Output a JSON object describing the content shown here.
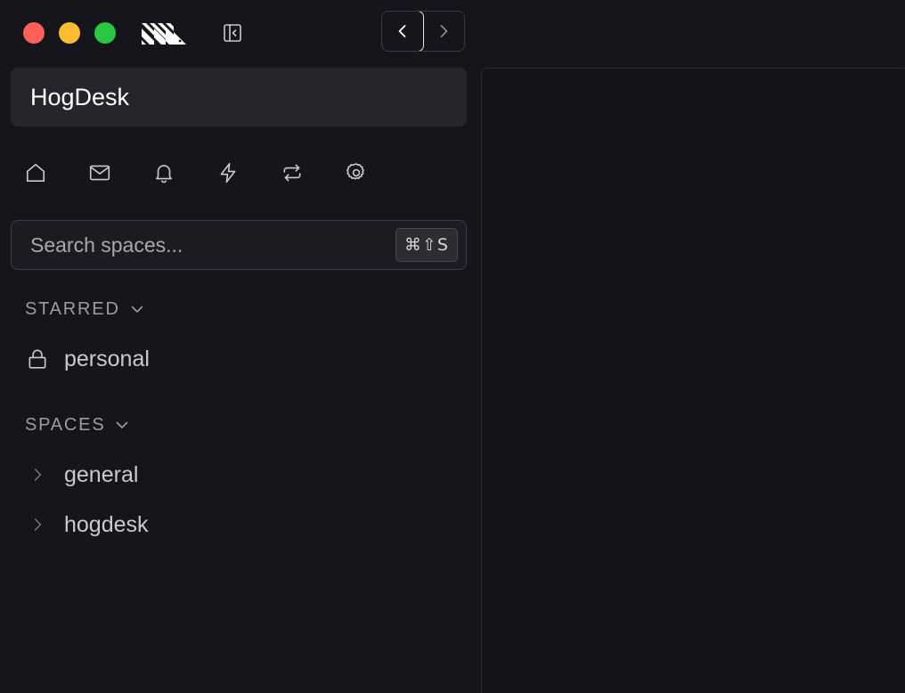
{
  "window": {
    "controls": {
      "close": "#fe5f57",
      "minimize": "#febc2e",
      "zoom": "#28c840"
    }
  },
  "toolbar": {
    "logo_icon": "hogdesk-logo-icon",
    "sidebar_toggle_icon": "sidebar-collapse-icon",
    "back_icon": "chevron-left-icon",
    "forward_icon": "chevron-right-icon"
  },
  "workspace": {
    "name": "HogDesk"
  },
  "nav_icons": [
    "home-icon",
    "inbox-icon",
    "bell-icon",
    "lightning-icon",
    "repeat-icon",
    "gear-icon"
  ],
  "search": {
    "placeholder": "Search spaces...",
    "shortcut": "⌘⇧S"
  },
  "starred": {
    "header": "STARRED",
    "items": [
      {
        "label": "personal",
        "icon": "lock-icon"
      }
    ]
  },
  "spaces": {
    "header": "SPACES",
    "items": [
      {
        "label": "general",
        "icon": "chevron-right-icon"
      },
      {
        "label": "hogdesk",
        "icon": "chevron-right-icon"
      }
    ]
  },
  "colors": {
    "background": "#15161b",
    "surface": "#25262c",
    "border": "#3a3c44",
    "text_primary": "#ffffff",
    "text_secondary": "#c9cace",
    "text_muted": "#9c9da3"
  }
}
